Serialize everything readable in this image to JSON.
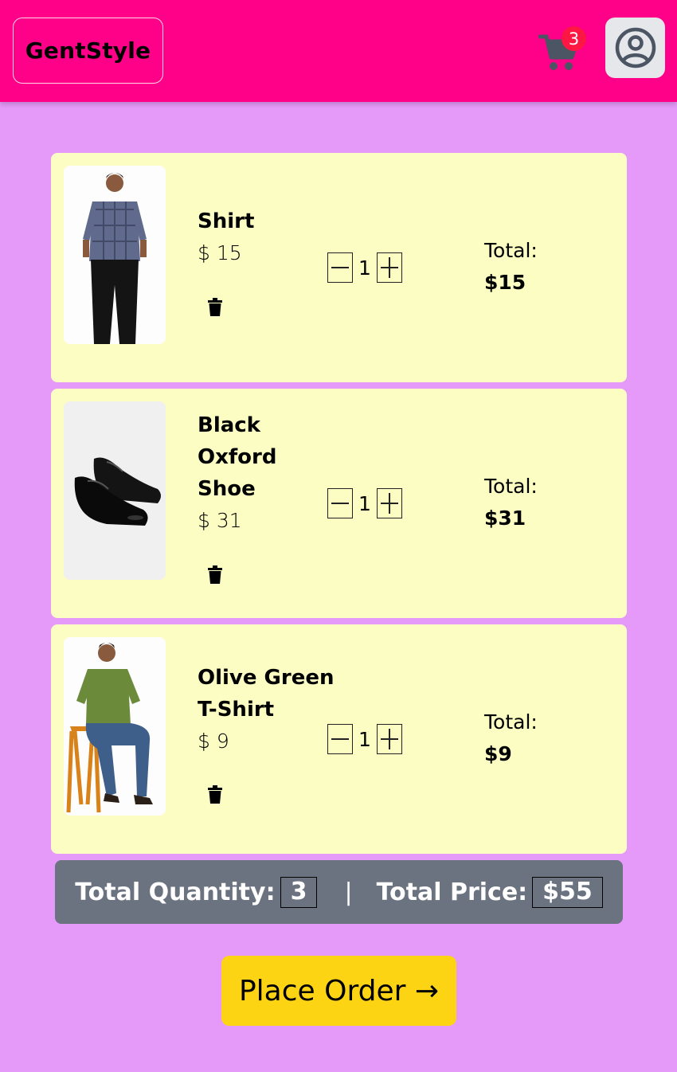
{
  "brand": "GentStyle",
  "header": {
    "cart_count": "3",
    "cart_icon": "cart-icon",
    "profile_icon": "user-circle-icon"
  },
  "cart_items": [
    {
      "name": "Shirt",
      "price": "$ 15",
      "quantity": "1",
      "total_label": "Total:",
      "total": "$15"
    },
    {
      "name": "Black Oxford Shoe",
      "price": "$ 31",
      "quantity": "1",
      "total_label": "Total:",
      "total": "$31"
    },
    {
      "name": "Olive Green T-Shirt",
      "price": "$ 9",
      "quantity": "1",
      "total_label": "Total:",
      "total": "$9"
    }
  ],
  "summary": {
    "qty_label": "Total Quantity:",
    "qty": "3",
    "separator": "|",
    "price_label": "Total Price:",
    "price": "$55"
  },
  "place_order_label": "Place Order →",
  "colors": {
    "page_bg": "#e59af9",
    "navbar_bg": "#ff0088",
    "card_bg": "#fbfdc2",
    "summary_bg": "#6b7280",
    "button_bg": "#fdd413",
    "badge_bg": "#ff1744"
  }
}
